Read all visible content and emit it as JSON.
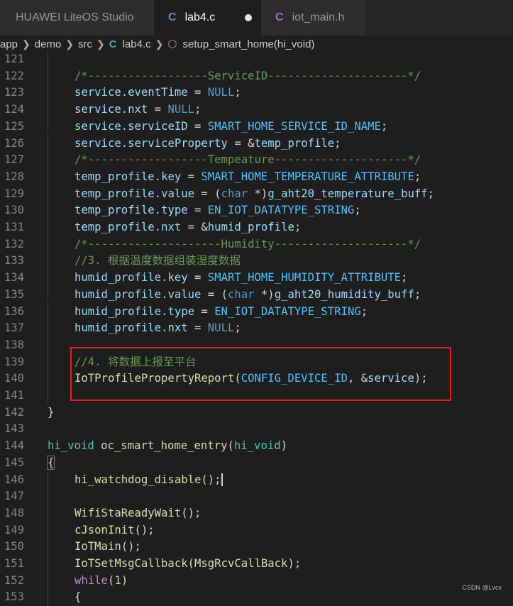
{
  "tabs": [
    {
      "label": "HUAWEI LiteOS Studio",
      "active": false
    },
    {
      "label": "lab4.c",
      "icon": "C",
      "active": true,
      "modified": true
    },
    {
      "label": "iot_main.h",
      "icon": "C",
      "active": false
    }
  ],
  "breadcrumb": {
    "items": [
      "app",
      "demo",
      "src",
      "lab4.c",
      "setup_smart_home(hi_void)"
    ]
  },
  "code_lines": [
    {
      "n": "121",
      "indent": 1,
      "tokens": []
    },
    {
      "n": "122",
      "indent": 1,
      "tokens": [
        {
          "t": "/*------------------ServiceID---------------------*/",
          "c": "cmt"
        }
      ]
    },
    {
      "n": "123",
      "indent": 1,
      "tokens": [
        {
          "t": "service",
          "c": "var"
        },
        {
          "t": ".",
          "c": "op"
        },
        {
          "t": "eventTime",
          "c": "var"
        },
        {
          "t": " = ",
          "c": "op"
        },
        {
          "t": "NULL",
          "c": "kw"
        },
        {
          "t": ";",
          "c": "op"
        }
      ]
    },
    {
      "n": "124",
      "indent": 1,
      "tokens": [
        {
          "t": "service",
          "c": "var"
        },
        {
          "t": ".",
          "c": "op"
        },
        {
          "t": "nxt",
          "c": "var"
        },
        {
          "t": " = ",
          "c": "op"
        },
        {
          "t": "NULL",
          "c": "kw"
        },
        {
          "t": ";",
          "c": "op"
        }
      ]
    },
    {
      "n": "125",
      "indent": 1,
      "tokens": [
        {
          "t": "service",
          "c": "var"
        },
        {
          "t": ".",
          "c": "op"
        },
        {
          "t": "serviceID",
          "c": "var"
        },
        {
          "t": " = ",
          "c": "op"
        },
        {
          "t": "SMART_HOME_SERVICE_ID_NAME",
          "c": "const"
        },
        {
          "t": ";",
          "c": "op"
        }
      ]
    },
    {
      "n": "126",
      "indent": 1,
      "tokens": [
        {
          "t": "service",
          "c": "var"
        },
        {
          "t": ".",
          "c": "op"
        },
        {
          "t": "serviceProperty",
          "c": "var"
        },
        {
          "t": " = &",
          "c": "op"
        },
        {
          "t": "temp_profile",
          "c": "var"
        },
        {
          "t": ";",
          "c": "op"
        }
      ]
    },
    {
      "n": "127",
      "indent": 1,
      "tokens": [
        {
          "t": "/*------------------Tempeature--------------------*/",
          "c": "cmt"
        }
      ]
    },
    {
      "n": "128",
      "indent": 1,
      "tokens": [
        {
          "t": "temp_profile",
          "c": "var"
        },
        {
          "t": ".",
          "c": "op"
        },
        {
          "t": "key",
          "c": "var"
        },
        {
          "t": " = ",
          "c": "op"
        },
        {
          "t": "SMART_HOME_TEMPERATURE_ATTRIBUTE",
          "c": "const"
        },
        {
          "t": ";",
          "c": "op"
        }
      ]
    },
    {
      "n": "129",
      "indent": 1,
      "tokens": [
        {
          "t": "temp_profile",
          "c": "var"
        },
        {
          "t": ".",
          "c": "op"
        },
        {
          "t": "value",
          "c": "var"
        },
        {
          "t": " = (",
          "c": "op"
        },
        {
          "t": "char",
          "c": "kw"
        },
        {
          "t": " *)",
          "c": "op"
        },
        {
          "t": "g_aht20_temperature_buff",
          "c": "var"
        },
        {
          "t": ";",
          "c": "op"
        }
      ]
    },
    {
      "n": "130",
      "indent": 1,
      "tokens": [
        {
          "t": "temp_profile",
          "c": "var"
        },
        {
          "t": ".",
          "c": "op"
        },
        {
          "t": "type",
          "c": "var"
        },
        {
          "t": " = ",
          "c": "op"
        },
        {
          "t": "EN_IOT_DATATYPE_STRING",
          "c": "const"
        },
        {
          "t": ";",
          "c": "op"
        }
      ]
    },
    {
      "n": "131",
      "indent": 1,
      "tokens": [
        {
          "t": "temp_profile",
          "c": "var"
        },
        {
          "t": ".",
          "c": "op"
        },
        {
          "t": "nxt",
          "c": "var"
        },
        {
          "t": " = &",
          "c": "op"
        },
        {
          "t": "humid_profile",
          "c": "var"
        },
        {
          "t": ";",
          "c": "op"
        }
      ]
    },
    {
      "n": "132",
      "indent": 1,
      "tokens": [
        {
          "t": "/*--------------------Humidity--------------------*/",
          "c": "cmt"
        }
      ]
    },
    {
      "n": "133",
      "indent": 1,
      "tokens": [
        {
          "t": "//3. 根据温度数据组装湿度数据",
          "c": "cmt"
        }
      ]
    },
    {
      "n": "134",
      "indent": 1,
      "tokens": [
        {
          "t": "humid_profile",
          "c": "var"
        },
        {
          "t": ".",
          "c": "op"
        },
        {
          "t": "key",
          "c": "var"
        },
        {
          "t": " = ",
          "c": "op"
        },
        {
          "t": "SMART_HOME_HUMIDITY_ATTRIBUTE",
          "c": "const"
        },
        {
          "t": ";",
          "c": "op"
        }
      ]
    },
    {
      "n": "135",
      "indent": 1,
      "tokens": [
        {
          "t": "humid_profile",
          "c": "var"
        },
        {
          "t": ".",
          "c": "op"
        },
        {
          "t": "value",
          "c": "var"
        },
        {
          "t": " = (",
          "c": "op"
        },
        {
          "t": "char",
          "c": "kw"
        },
        {
          "t": " *)",
          "c": "op"
        },
        {
          "t": "g_aht20_humidity_buff",
          "c": "var"
        },
        {
          "t": ";",
          "c": "op"
        }
      ]
    },
    {
      "n": "136",
      "indent": 1,
      "tokens": [
        {
          "t": "humid_profile",
          "c": "var"
        },
        {
          "t": ".",
          "c": "op"
        },
        {
          "t": "type",
          "c": "var"
        },
        {
          "t": " = ",
          "c": "op"
        },
        {
          "t": "EN_IOT_DATATYPE_STRING",
          "c": "const"
        },
        {
          "t": ";",
          "c": "op"
        }
      ]
    },
    {
      "n": "137",
      "indent": 1,
      "tokens": [
        {
          "t": "humid_profile",
          "c": "var"
        },
        {
          "t": ".",
          "c": "op"
        },
        {
          "t": "nxt",
          "c": "var"
        },
        {
          "t": " = ",
          "c": "op"
        },
        {
          "t": "NULL",
          "c": "kw"
        },
        {
          "t": ";",
          "c": "op"
        }
      ]
    },
    {
      "n": "138",
      "indent": 1,
      "tokens": []
    },
    {
      "n": "139",
      "indent": 1,
      "tokens": [
        {
          "t": "//4. 将数据上报至平台",
          "c": "cmt"
        }
      ]
    },
    {
      "n": "140",
      "indent": 1,
      "tokens": [
        {
          "t": "IoTProfilePropertyReport",
          "c": "fn"
        },
        {
          "t": "(",
          "c": "op"
        },
        {
          "t": "CONFIG_DEVICE_ID",
          "c": "const"
        },
        {
          "t": ", &",
          "c": "op"
        },
        {
          "t": "service",
          "c": "var"
        },
        {
          "t": ");",
          "c": "op"
        }
      ]
    },
    {
      "n": "141",
      "indent": 1,
      "tokens": []
    },
    {
      "n": "142",
      "indent": 0,
      "tokens": [
        {
          "t": "}",
          "c": "op"
        }
      ]
    },
    {
      "n": "143",
      "indent": 0,
      "tokens": []
    },
    {
      "n": "144",
      "indent": 0,
      "tokens": [
        {
          "t": "hi_void",
          "c": "typ"
        },
        {
          "t": " ",
          "c": "op"
        },
        {
          "t": "oc_smart_home_entry",
          "c": "fn"
        },
        {
          "t": "(",
          "c": "op"
        },
        {
          "t": "hi_void",
          "c": "typ"
        },
        {
          "t": ")",
          "c": "op"
        }
      ]
    },
    {
      "n": "145",
      "indent": 0,
      "tokens": [
        {
          "t": "{",
          "c": "op",
          "boxed": true
        }
      ]
    },
    {
      "n": "146",
      "indent": 1,
      "cursor": true,
      "tokens": [
        {
          "t": "hi_watchdog_disable",
          "c": "fn"
        },
        {
          "t": "();",
          "c": "op"
        }
      ]
    },
    {
      "n": "147",
      "indent": 1,
      "tokens": []
    },
    {
      "n": "148",
      "indent": 1,
      "tokens": [
        {
          "t": "WifiStaReadyWait",
          "c": "fn"
        },
        {
          "t": "();",
          "c": "op"
        }
      ]
    },
    {
      "n": "149",
      "indent": 1,
      "tokens": [
        {
          "t": "cJsonInit",
          "c": "fn"
        },
        {
          "t": "();",
          "c": "op"
        }
      ]
    },
    {
      "n": "150",
      "indent": 1,
      "tokens": [
        {
          "t": "IoTMain",
          "c": "fn"
        },
        {
          "t": "();",
          "c": "op"
        }
      ]
    },
    {
      "n": "151",
      "indent": 1,
      "tokens": [
        {
          "t": "IoTSetMsgCallback",
          "c": "fn"
        },
        {
          "t": "(",
          "c": "op"
        },
        {
          "t": "MsgRcvCallBack",
          "c": "fn"
        },
        {
          "t": ");",
          "c": "op"
        }
      ]
    },
    {
      "n": "152",
      "indent": 1,
      "tokens": [
        {
          "t": "while",
          "c": "ctl"
        },
        {
          "t": "(",
          "c": "op"
        },
        {
          "t": "1",
          "c": "num"
        },
        {
          "t": ")",
          "c": "op"
        }
      ]
    },
    {
      "n": "153",
      "indent": 1,
      "tokens": [
        {
          "t": "{",
          "c": "op"
        }
      ]
    }
  ],
  "watermark": "CSDN @Lvcx"
}
